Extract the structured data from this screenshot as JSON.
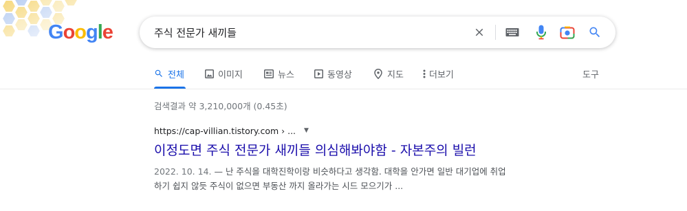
{
  "logo": {
    "letters": [
      "G",
      "o",
      "o",
      "g",
      "l",
      "e"
    ],
    "colors": [
      "#4285F4",
      "#EA4335",
      "#FBBC05",
      "#4285F4",
      "#34A853",
      "#EA4335"
    ]
  },
  "search": {
    "query": "주식 전문가 새끼들",
    "icons": [
      "clear-icon",
      "keyboard-icon",
      "microphone-icon",
      "camera-lens-icon",
      "search-icon"
    ]
  },
  "tabs": [
    {
      "label": "전체",
      "icon": "search-icon",
      "active": true
    },
    {
      "label": "이미지",
      "icon": "image-icon",
      "active": false
    },
    {
      "label": "뉴스",
      "icon": "news-icon",
      "active": false
    },
    {
      "label": "동영상",
      "icon": "video-icon",
      "active": false
    },
    {
      "label": "지도",
      "icon": "map-pin-icon",
      "active": false
    },
    {
      "label": "더보기",
      "icon": "more-vert-icon",
      "active": false
    }
  ],
  "tools_label": "도구",
  "result_stats": "검색결과 약 3,210,000개 (0.45초)",
  "result": {
    "url": "https://cap-villian.tistory.com › ...",
    "title": "이정도면 주식 전문가 새끼들 의심해봐야함 - 자본주의 빌런",
    "date": "2022. 10. 14.",
    "snippet_line1": " — 난 주식을 대학진학이랑 비슷하다고 생각함. 대학을 안가면 일반 대기업에 취업",
    "snippet_line2": "하기 쉽지 않듯 주식이 없으면 부동산 까지 올라가는 시드 모으기가 ..."
  },
  "colors": {
    "accent": "#1a73e8",
    "link": "#1a0dab",
    "muted": "#70757a",
    "honeycomb_yellow": "#f6d87c",
    "honeycomb_blue": "#b7cdf2"
  }
}
